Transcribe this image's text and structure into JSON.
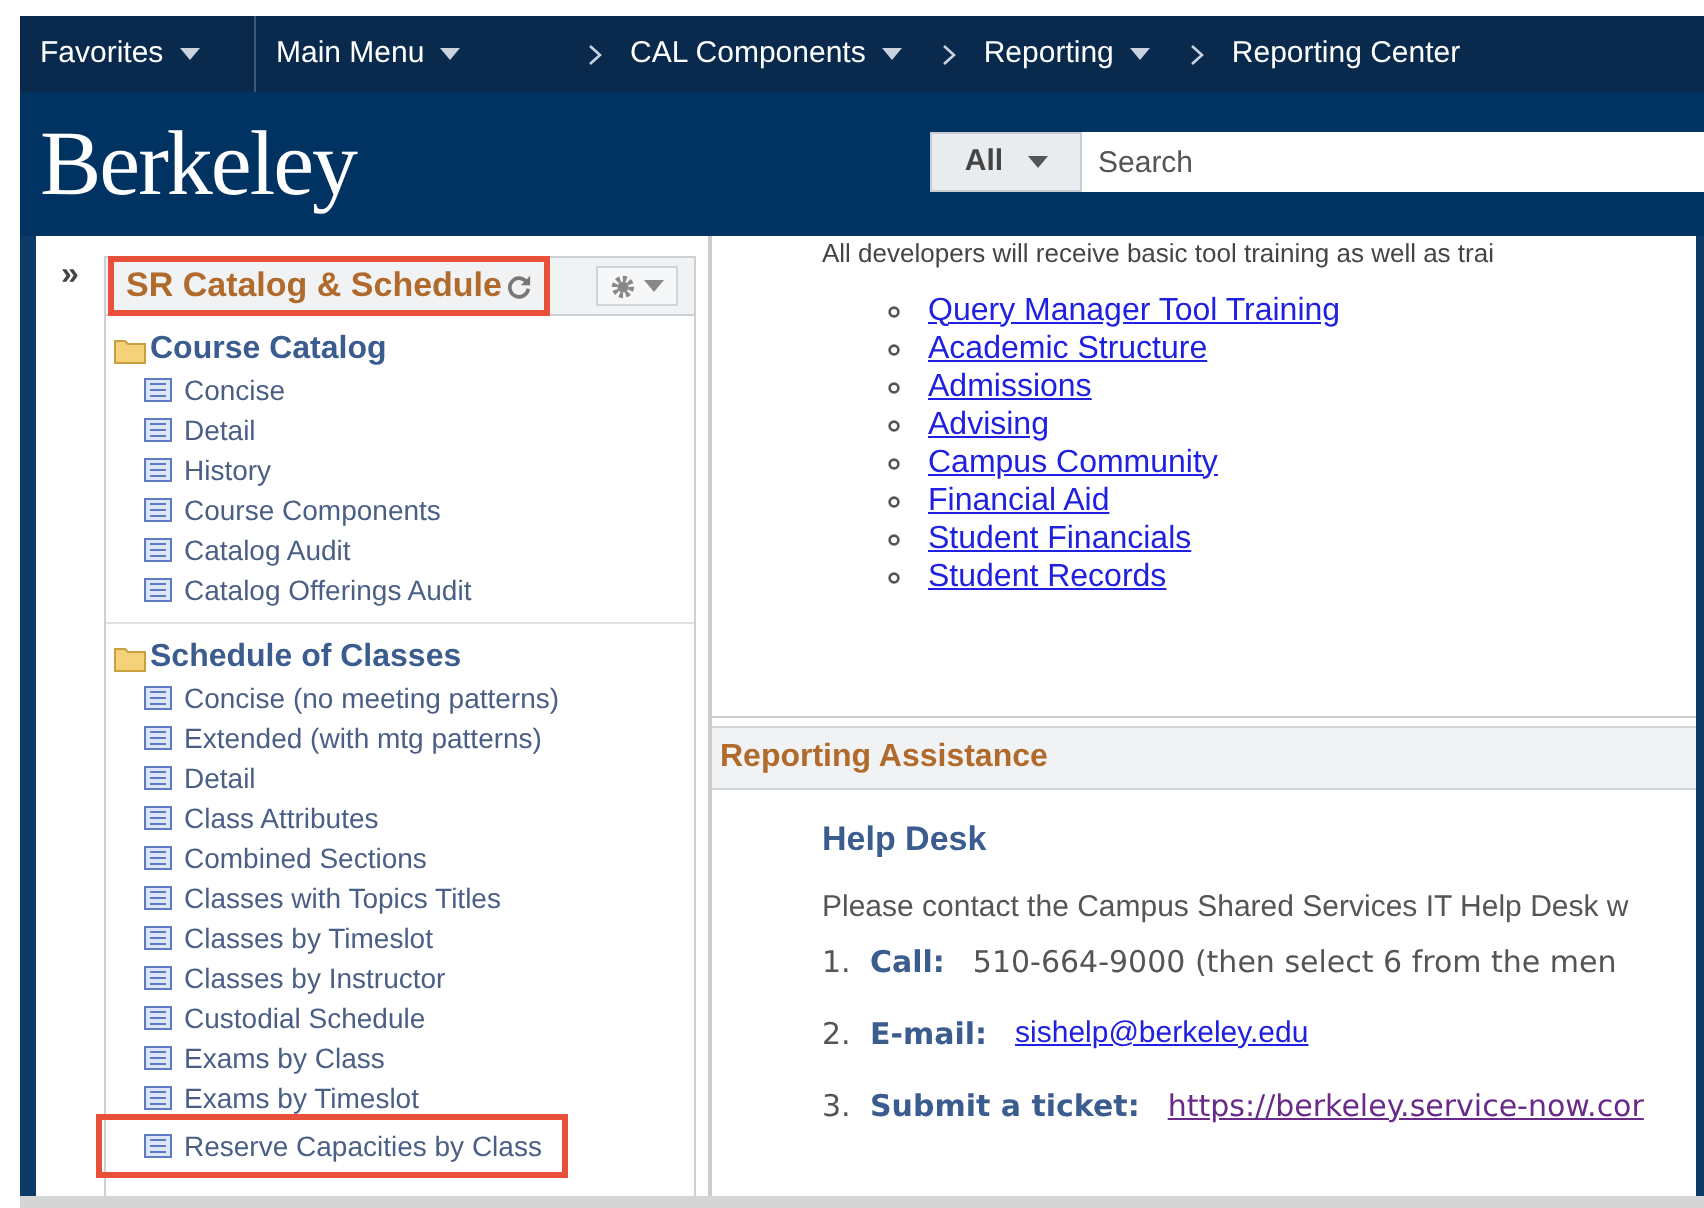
{
  "nav": {
    "items": [
      {
        "label": "Favorites",
        "dropdown": true
      },
      {
        "label": "Main Menu",
        "dropdown": true
      }
    ],
    "breadcrumbs": [
      {
        "label": "CAL Components",
        "dropdown": true
      },
      {
        "label": "Reporting",
        "dropdown": true
      },
      {
        "label": "Reporting Center",
        "dropdown": false
      }
    ]
  },
  "header": {
    "logo": "Berkeley",
    "search": {
      "scope": "All",
      "placeholder": "Search"
    }
  },
  "sidebar": {
    "collapse": "»",
    "pagelet": {
      "title": "SR Catalog & Schedule",
      "highlighted": true,
      "sections": [
        {
          "title": "Course Catalog",
          "items": [
            {
              "label": "Concise",
              "highlighted": false
            },
            {
              "label": "Detail",
              "highlighted": false
            },
            {
              "label": "History",
              "highlighted": false
            },
            {
              "label": "Course Components",
              "highlighted": false
            },
            {
              "label": "Catalog Audit",
              "highlighted": false
            },
            {
              "label": "Catalog Offerings Audit",
              "highlighted": false
            }
          ]
        },
        {
          "title": "Schedule of Classes",
          "items": [
            {
              "label": "Concise (no meeting patterns)",
              "highlighted": false
            },
            {
              "label": "Extended (with mtg patterns)",
              "highlighted": false
            },
            {
              "label": "Detail",
              "highlighted": false
            },
            {
              "label": "Class Attributes",
              "highlighted": false
            },
            {
              "label": "Combined Sections",
              "highlighted": false
            },
            {
              "label": "Classes with Topics Titles",
              "highlighted": false
            },
            {
              "label": "Classes by Timeslot",
              "highlighted": false
            },
            {
              "label": "Classes by Instructor",
              "highlighted": false
            },
            {
              "label": "Custodial Schedule",
              "highlighted": false
            },
            {
              "label": "Exams by Class",
              "highlighted": false
            },
            {
              "label": "Exams by Timeslot",
              "highlighted": false
            },
            {
              "label": "Reserve Capacities by Class",
              "highlighted": true
            }
          ]
        }
      ]
    }
  },
  "content": {
    "intro": "All developers will receive basic tool training as well as trai",
    "links": [
      "Query Manager Tool Training",
      "Academic Structure",
      "Admissions",
      "Advising",
      "Campus Community",
      "Financial Aid",
      "Student Financials",
      "Student Records"
    ],
    "assistance": {
      "title": "Reporting Assistance",
      "heading": "Help Desk",
      "text": "Please contact the Campus Shared Services IT Help Desk w",
      "contacts": [
        {
          "number": "1.",
          "label": "Call:",
          "text": "510-664-9000 (then select 6 from the men"
        },
        {
          "number": "2.",
          "label": "E-mail:",
          "link": "sishelp@berkeley.edu"
        },
        {
          "number": "3.",
          "label": "Submit a ticket:",
          "link": "https://berkeley.service-now.cor"
        }
      ]
    }
  }
}
